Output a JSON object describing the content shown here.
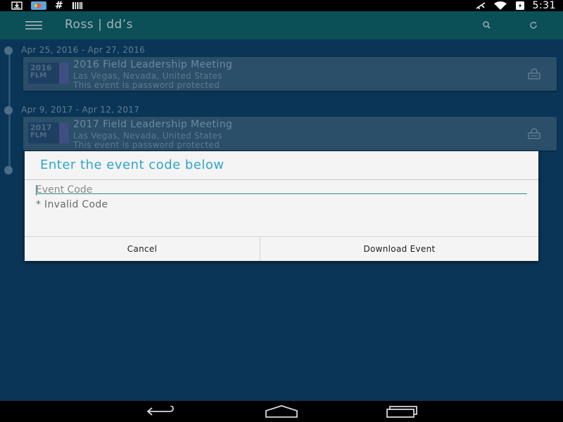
{
  "status_bar": {
    "notification_icons": [
      "download-icon",
      "photos-app-icon",
      "hash-icon",
      "barcode-icon"
    ],
    "hash_glyph": "#",
    "right_icons": [
      "airplane-mode-icon",
      "wifi-icon",
      "battery-icon"
    ],
    "time": "5:31"
  },
  "app_bar": {
    "title": "Ross | dd’s",
    "icons": [
      "menu-icon",
      "search-icon",
      "refresh-icon"
    ]
  },
  "events": [
    {
      "date_range": "Apr 25, 2016 - Apr 27, 2016",
      "thumb_year": "2016",
      "thumb_sub": "FLM",
      "title": "2016 Field Leadership Meeting",
      "location": "Las Vegas, Nevada, United States",
      "protected_note": "This event is password protected"
    },
    {
      "date_range": "Apr 9, 2017 - Apr 12, 2017",
      "thumb_year": "2017",
      "thumb_sub": "FLM",
      "title": "2017 Field Leadership Meeting",
      "location": "Las Vegas, Nevada, United States",
      "protected_note": "This event is password protected"
    }
  ],
  "dialog": {
    "title": "Enter the event code below",
    "input_placeholder": "Event Code",
    "input_value": "",
    "error_message": "* Invalid Code",
    "cancel_label": "Cancel",
    "download_label": "Download Event"
  },
  "nav_bar": {
    "icons": [
      "back-icon",
      "home-icon",
      "recents-icon"
    ]
  },
  "colors": {
    "app_bar": "#0b4f57",
    "background": "#0b3556",
    "dialog_title": "#2fa6c9",
    "input_accent": "#2a8d8d"
  }
}
